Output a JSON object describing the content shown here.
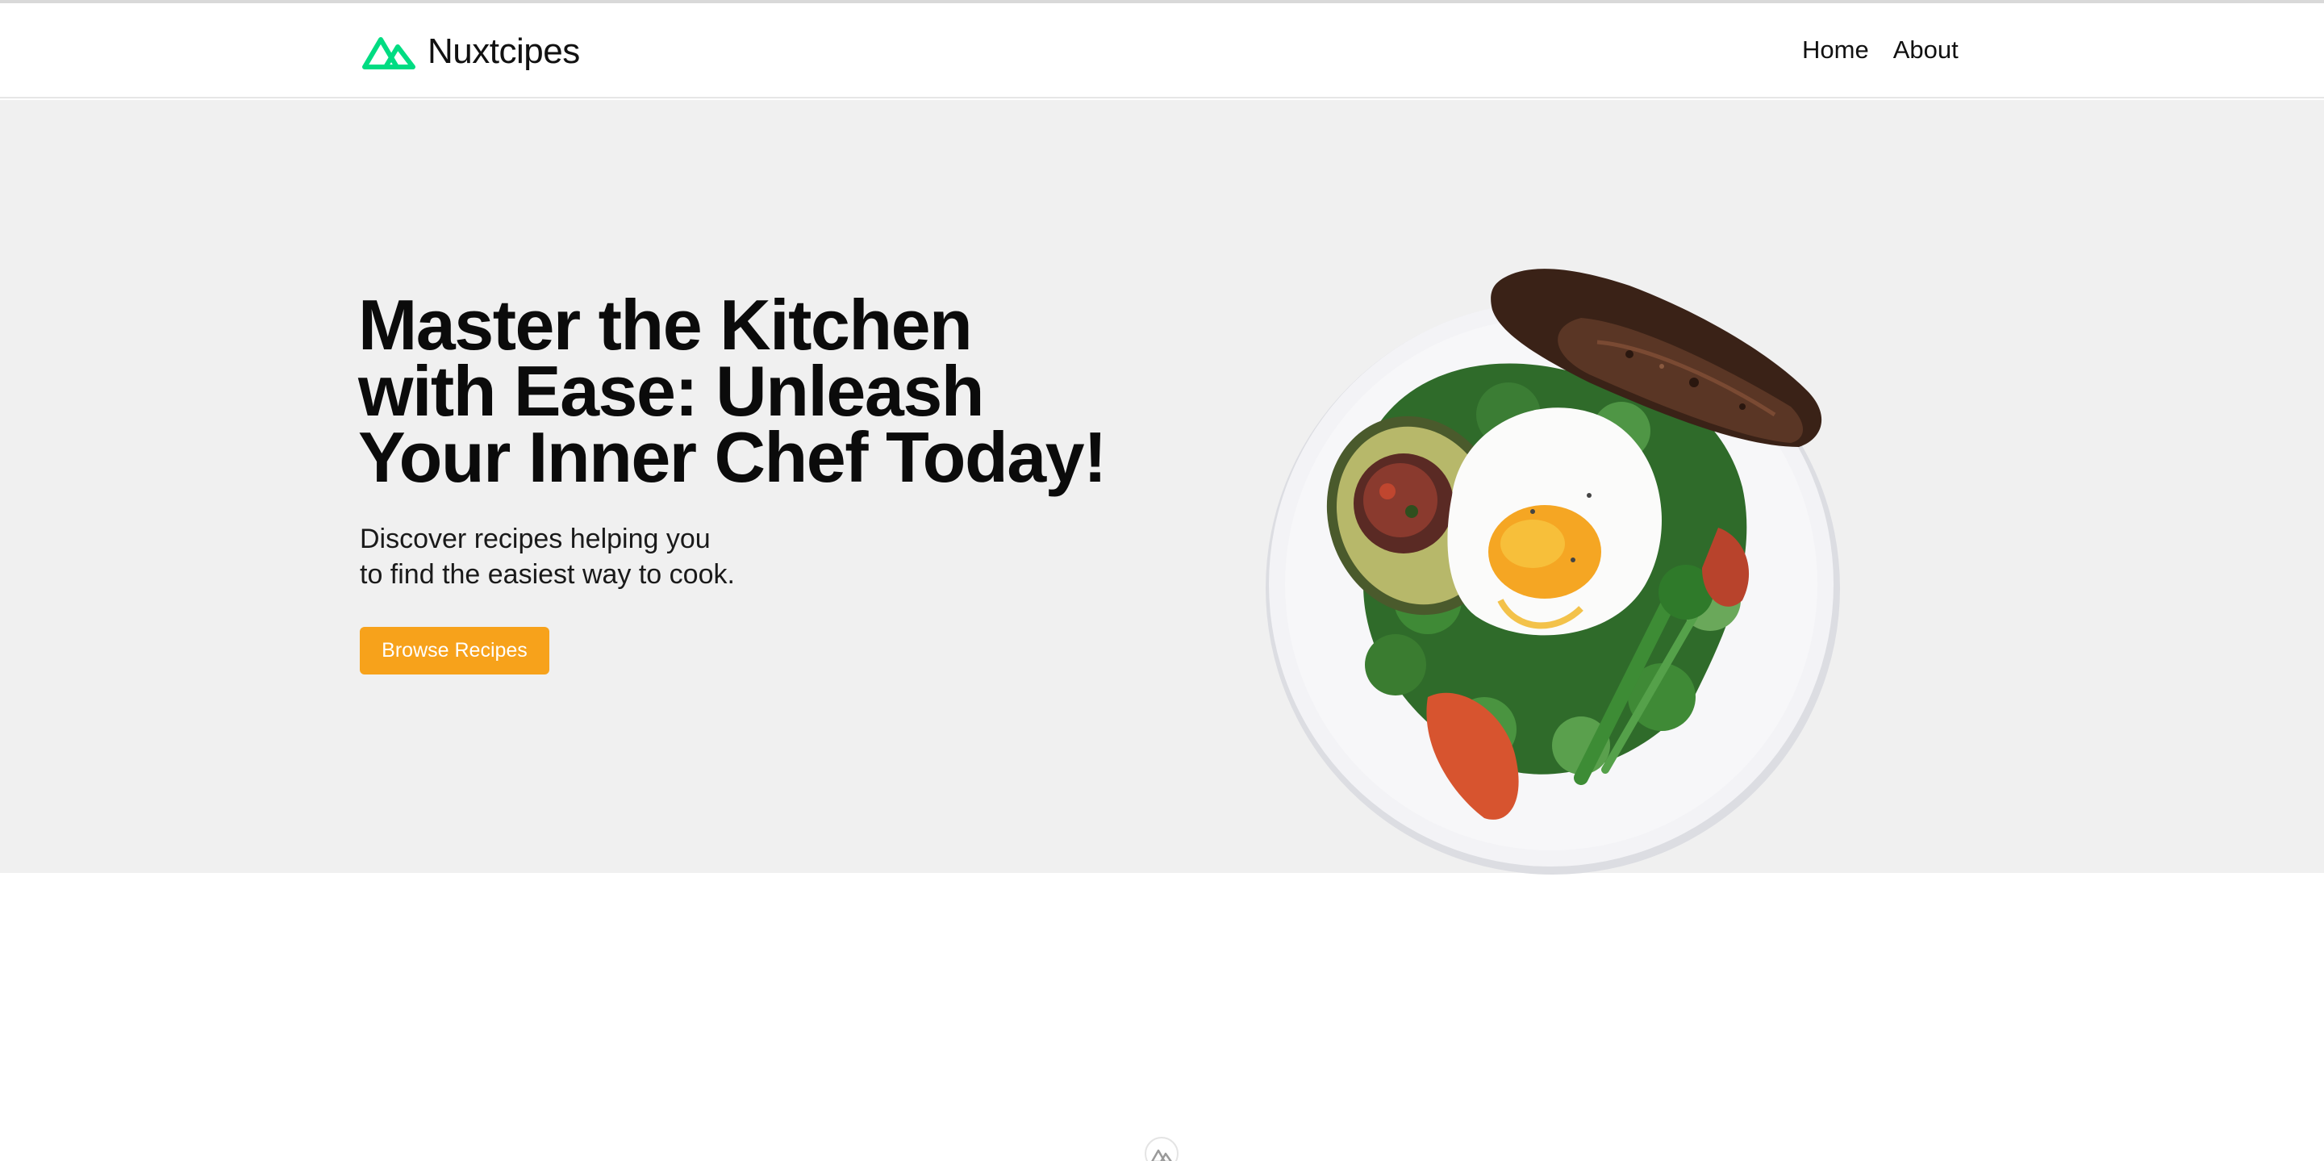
{
  "header": {
    "brand_name": "Nuxtcipes",
    "nav": [
      {
        "label": "Home"
      },
      {
        "label": "About"
      }
    ]
  },
  "hero": {
    "title_lines": [
      "Master the Kitchen",
      "with Ease: Unleash",
      "Your Inner Chef Today!"
    ],
    "subtitle_lines": [
      "Discover recipes helping you",
      "to find the easiest way to cook."
    ],
    "cta_label": "Browse Recipes",
    "image_alt": "plate with poached egg, avocado, greens and rye bread"
  },
  "icons": {
    "logo": "nuxt-mountain-logo-icon",
    "footer": "nuxt-mountain-footer-icon"
  },
  "colors": {
    "brand_green": "#00DC82",
    "accent_orange": "#F7A21B",
    "hero_bg": "#F0F0F0",
    "text": "#0B0B0B"
  }
}
